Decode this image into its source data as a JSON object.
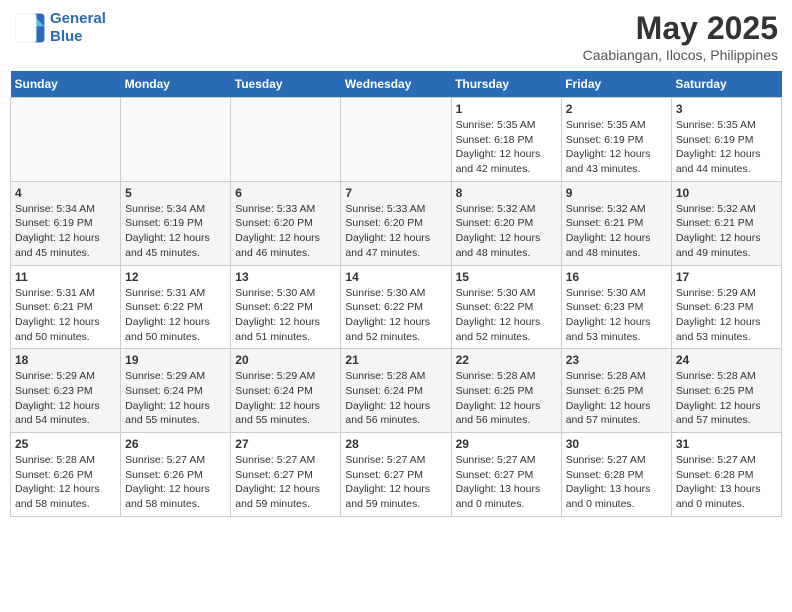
{
  "header": {
    "logo_line1": "General",
    "logo_line2": "Blue",
    "title": "May 2025",
    "subtitle": "Caabiangan, Ilocos, Philippines"
  },
  "days_of_week": [
    "Sunday",
    "Monday",
    "Tuesday",
    "Wednesday",
    "Thursday",
    "Friday",
    "Saturday"
  ],
  "weeks": [
    {
      "days": [
        {
          "num": "",
          "info": ""
        },
        {
          "num": "",
          "info": ""
        },
        {
          "num": "",
          "info": ""
        },
        {
          "num": "",
          "info": ""
        },
        {
          "num": "1",
          "info": "Sunrise: 5:35 AM\nSunset: 6:18 PM\nDaylight: 12 hours\nand 42 minutes."
        },
        {
          "num": "2",
          "info": "Sunrise: 5:35 AM\nSunset: 6:19 PM\nDaylight: 12 hours\nand 43 minutes."
        },
        {
          "num": "3",
          "info": "Sunrise: 5:35 AM\nSunset: 6:19 PM\nDaylight: 12 hours\nand 44 minutes."
        }
      ]
    },
    {
      "days": [
        {
          "num": "4",
          "info": "Sunrise: 5:34 AM\nSunset: 6:19 PM\nDaylight: 12 hours\nand 45 minutes."
        },
        {
          "num": "5",
          "info": "Sunrise: 5:34 AM\nSunset: 6:19 PM\nDaylight: 12 hours\nand 45 minutes."
        },
        {
          "num": "6",
          "info": "Sunrise: 5:33 AM\nSunset: 6:20 PM\nDaylight: 12 hours\nand 46 minutes."
        },
        {
          "num": "7",
          "info": "Sunrise: 5:33 AM\nSunset: 6:20 PM\nDaylight: 12 hours\nand 47 minutes."
        },
        {
          "num": "8",
          "info": "Sunrise: 5:32 AM\nSunset: 6:20 PM\nDaylight: 12 hours\nand 48 minutes."
        },
        {
          "num": "9",
          "info": "Sunrise: 5:32 AM\nSunset: 6:21 PM\nDaylight: 12 hours\nand 48 minutes."
        },
        {
          "num": "10",
          "info": "Sunrise: 5:32 AM\nSunset: 6:21 PM\nDaylight: 12 hours\nand 49 minutes."
        }
      ]
    },
    {
      "days": [
        {
          "num": "11",
          "info": "Sunrise: 5:31 AM\nSunset: 6:21 PM\nDaylight: 12 hours\nand 50 minutes."
        },
        {
          "num": "12",
          "info": "Sunrise: 5:31 AM\nSunset: 6:22 PM\nDaylight: 12 hours\nand 50 minutes."
        },
        {
          "num": "13",
          "info": "Sunrise: 5:30 AM\nSunset: 6:22 PM\nDaylight: 12 hours\nand 51 minutes."
        },
        {
          "num": "14",
          "info": "Sunrise: 5:30 AM\nSunset: 6:22 PM\nDaylight: 12 hours\nand 52 minutes."
        },
        {
          "num": "15",
          "info": "Sunrise: 5:30 AM\nSunset: 6:22 PM\nDaylight: 12 hours\nand 52 minutes."
        },
        {
          "num": "16",
          "info": "Sunrise: 5:30 AM\nSunset: 6:23 PM\nDaylight: 12 hours\nand 53 minutes."
        },
        {
          "num": "17",
          "info": "Sunrise: 5:29 AM\nSunset: 6:23 PM\nDaylight: 12 hours\nand 53 minutes."
        }
      ]
    },
    {
      "days": [
        {
          "num": "18",
          "info": "Sunrise: 5:29 AM\nSunset: 6:23 PM\nDaylight: 12 hours\nand 54 minutes."
        },
        {
          "num": "19",
          "info": "Sunrise: 5:29 AM\nSunset: 6:24 PM\nDaylight: 12 hours\nand 55 minutes."
        },
        {
          "num": "20",
          "info": "Sunrise: 5:29 AM\nSunset: 6:24 PM\nDaylight: 12 hours\nand 55 minutes."
        },
        {
          "num": "21",
          "info": "Sunrise: 5:28 AM\nSunset: 6:24 PM\nDaylight: 12 hours\nand 56 minutes."
        },
        {
          "num": "22",
          "info": "Sunrise: 5:28 AM\nSunset: 6:25 PM\nDaylight: 12 hours\nand 56 minutes."
        },
        {
          "num": "23",
          "info": "Sunrise: 5:28 AM\nSunset: 6:25 PM\nDaylight: 12 hours\nand 57 minutes."
        },
        {
          "num": "24",
          "info": "Sunrise: 5:28 AM\nSunset: 6:25 PM\nDaylight: 12 hours\nand 57 minutes."
        }
      ]
    },
    {
      "days": [
        {
          "num": "25",
          "info": "Sunrise: 5:28 AM\nSunset: 6:26 PM\nDaylight: 12 hours\nand 58 minutes."
        },
        {
          "num": "26",
          "info": "Sunrise: 5:27 AM\nSunset: 6:26 PM\nDaylight: 12 hours\nand 58 minutes."
        },
        {
          "num": "27",
          "info": "Sunrise: 5:27 AM\nSunset: 6:27 PM\nDaylight: 12 hours\nand 59 minutes."
        },
        {
          "num": "28",
          "info": "Sunrise: 5:27 AM\nSunset: 6:27 PM\nDaylight: 12 hours\nand 59 minutes."
        },
        {
          "num": "29",
          "info": "Sunrise: 5:27 AM\nSunset: 6:27 PM\nDaylight: 13 hours\nand 0 minutes."
        },
        {
          "num": "30",
          "info": "Sunrise: 5:27 AM\nSunset: 6:28 PM\nDaylight: 13 hours\nand 0 minutes."
        },
        {
          "num": "31",
          "info": "Sunrise: 5:27 AM\nSunset: 6:28 PM\nDaylight: 13 hours\nand 0 minutes."
        }
      ]
    }
  ]
}
